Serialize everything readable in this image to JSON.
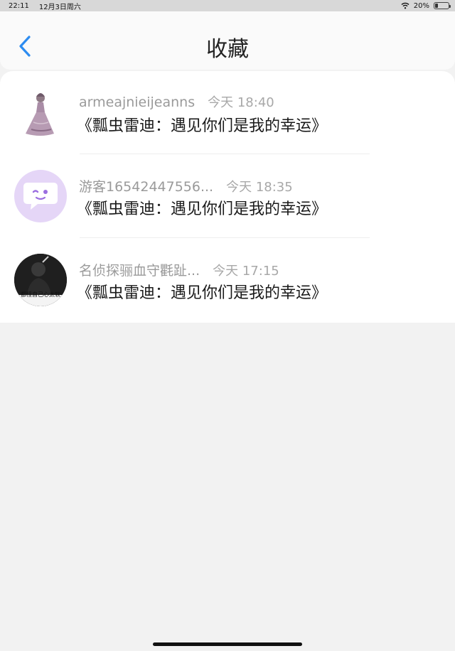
{
  "status": {
    "time": "22:11",
    "date": "12月3日周六",
    "battery": "20%",
    "battery_level": 0.2
  },
  "nav": {
    "title": "收藏",
    "back_icon": "chevron-left-icon",
    "accent": "#2d8cf0"
  },
  "favorites": [
    {
      "user": "armeajnieijeanns",
      "time": "今天 18:40",
      "title": "《瓢虫雷迪：遇见你们是我的幸运》"
    },
    {
      "user": "游客16542447556...",
      "time": "今天 18:35",
      "title": "《瓢虫雷迪：遇见你们是我的幸运》"
    },
    {
      "user": "名侦探骊血守氍趾...",
      "time": "今天 17:15",
      "title": "《瓢虫雷迪：遇见你们是我的幸运》",
      "avatar_text": "都怪自己心太软"
    }
  ]
}
